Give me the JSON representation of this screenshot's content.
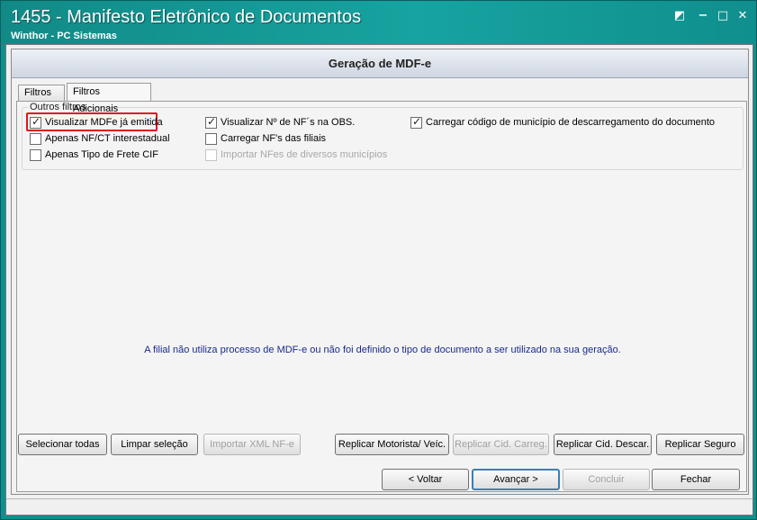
{
  "window": {
    "title": "1455 - Manifesto Eletrônico de Documentos",
    "subtitle": "Winthor - PC Sistemas",
    "controls": {
      "restore": "◩",
      "minimize": "−",
      "maximize": "□",
      "close": "✕"
    }
  },
  "header": {
    "title": "Geração de MDF-e"
  },
  "tabs": [
    {
      "label": "Filtros",
      "active": false
    },
    {
      "label": "Filtros Adicionais",
      "active": true
    }
  ],
  "filters_group": {
    "label": "Outros filtros",
    "checkboxes": [
      {
        "label": "Visualizar MDFe já emitida",
        "checked": true,
        "enabled": true,
        "highlighted": true
      },
      {
        "label": "Apenas NF/CT interestadual",
        "checked": false,
        "enabled": true
      },
      {
        "label": "Apenas Tipo de Frete CIF",
        "checked": false,
        "enabled": true
      },
      {
        "label": "Visualizar Nº de NF´s na OBS.",
        "checked": true,
        "enabled": true
      },
      {
        "label": "Carregar NF's das filiais",
        "checked": false,
        "enabled": true
      },
      {
        "label": "Importar NFes de diversos municípios",
        "checked": false,
        "enabled": false
      },
      {
        "label": "Carregar código de município de descarregamento do documento",
        "checked": true,
        "enabled": true
      }
    ]
  },
  "message": "A filial não utiliza processo de MDF-e ou não foi definido o tipo de documento a ser utilizado na sua geração.",
  "action_buttons": {
    "select_all": "Selecionar todas",
    "clear_selection": "Limpar seleção",
    "import_xml": "Importar XML NF-e",
    "replicate_driver": "Replicar Motorista/ Veíc.",
    "replicate_load_city": "Replicar Cid. Carreg.",
    "replicate_unload_city": "Replicar Cid. Descar.",
    "replicate_insurance": "Replicar Seguro"
  },
  "nav_buttons": {
    "back": "< Voltar",
    "next": "Avançar >",
    "finish": "Concluir",
    "close": "Fechar"
  },
  "colors": {
    "titlebar": "#118a87",
    "highlight": "#e3141c",
    "message": "#1a2a8a"
  }
}
